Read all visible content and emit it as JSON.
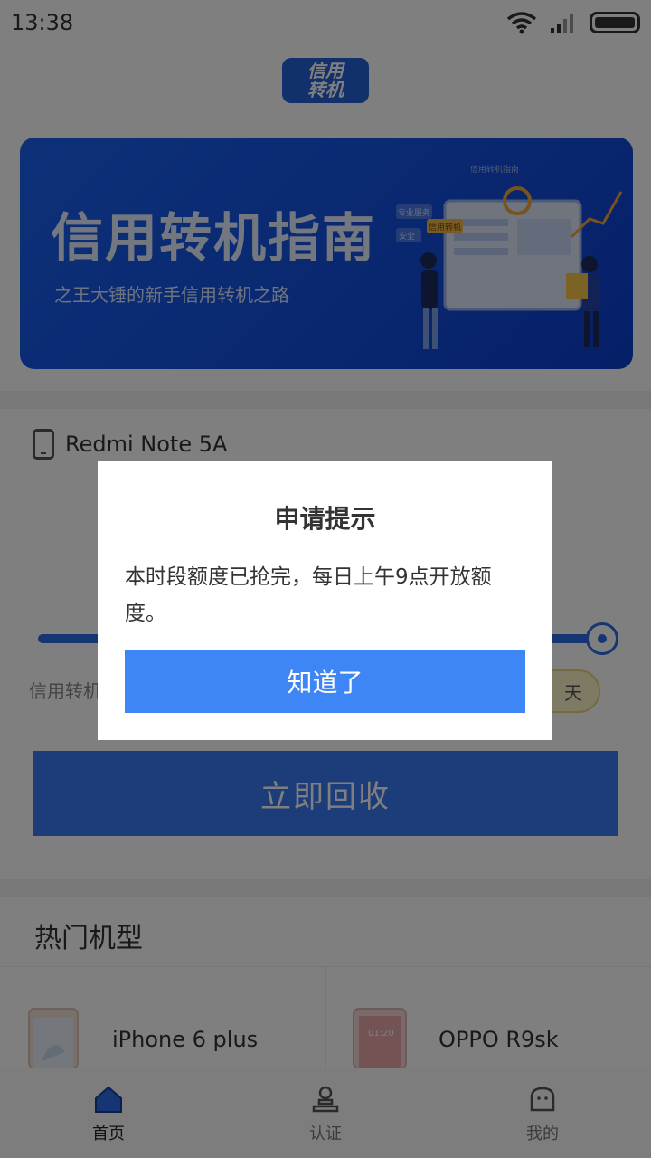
{
  "status_bar": {
    "time": "13:38"
  },
  "header": {
    "logo_line1": "信用",
    "logo_line2": "转机"
  },
  "banner": {
    "title": "信用转机指南",
    "subtitle": "之王大锤的新手信用转机之路",
    "illus_tag1": "信用转机指南",
    "illus_tag2": "专业服务",
    "illus_tag3": "安全",
    "illus_tag4": "信用转机"
  },
  "device": {
    "name": "Redmi Note 5A"
  },
  "credit": {
    "label": "信用转机",
    "days_text": "天"
  },
  "actions": {
    "recycle_label": "立即回收"
  },
  "hot": {
    "title": "热门机型",
    "items": [
      {
        "name": "iPhone 6 plus"
      },
      {
        "name": "OPPO R9sk",
        "screen_time": "01:20"
      }
    ]
  },
  "tabs": [
    {
      "label": "首页",
      "active": true
    },
    {
      "label": "认证",
      "active": false
    },
    {
      "label": "我的",
      "active": false
    }
  ],
  "dialog": {
    "title": "申请提示",
    "message": "本时段额度已抢完，每日上午9点开放额度。",
    "confirm_label": "知道了"
  },
  "colors": {
    "accent": "#3e86f5",
    "banner": "#1452e3"
  }
}
